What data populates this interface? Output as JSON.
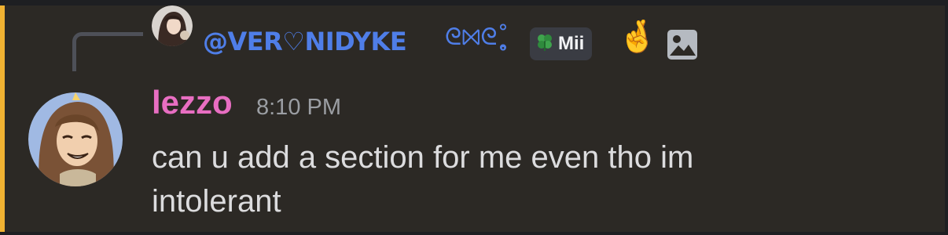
{
  "reply": {
    "author_name": "@VER♡NIDYKE",
    "decoration": "ᘓ⨝ᘓ˳̥̊",
    "clan_tag": "Mii",
    "emoji": "🤞"
  },
  "message": {
    "author": "lezzo",
    "timestamp": "8:10 PM",
    "text": "can u add a section for me even tho im intolerant"
  },
  "colors": {
    "accent_bar": "#f0b232",
    "reply_name": "#4f7ee8",
    "username": "#e86ec2",
    "background": "#2c2925"
  },
  "icons": {
    "clan_badge": "clover-icon",
    "attachment": "image-icon"
  }
}
